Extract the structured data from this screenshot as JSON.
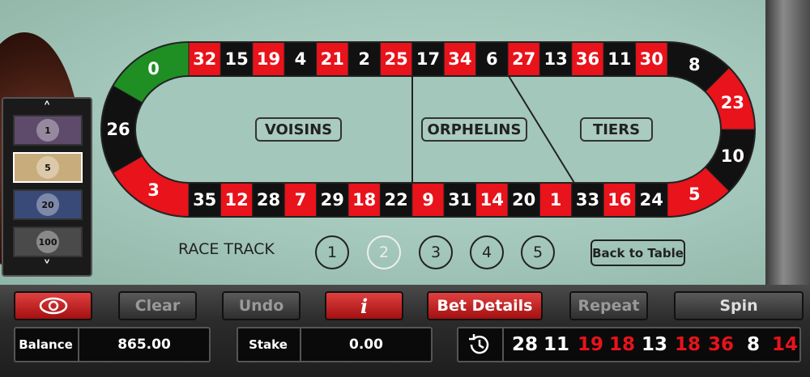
{
  "colors": {
    "red": "#e8131b",
    "black": "#111111",
    "green": "#1f8f24"
  },
  "race_track": {
    "top_row": [
      "32",
      "15",
      "19",
      "4",
      "21",
      "2",
      "25",
      "17",
      "34",
      "6",
      "27",
      "13",
      "36",
      "11",
      "30"
    ],
    "bottom_row": [
      "35",
      "12",
      "28",
      "7",
      "29",
      "18",
      "22",
      "9",
      "31",
      "14",
      "20",
      "1",
      "33",
      "16",
      "24"
    ],
    "left_curve": [
      "0",
      "26",
      "3"
    ],
    "right_curve": [
      "8",
      "23",
      "10",
      "5"
    ],
    "sections": {
      "voisins": "VOISINS",
      "orphelins": "ORPHELINS",
      "tiers": "TIERS"
    }
  },
  "neighbours": {
    "label": "RACE TRACK",
    "options": [
      "1",
      "2",
      "3",
      "4",
      "5"
    ],
    "selected": "2"
  },
  "back_to_table": "Back to Table",
  "chips": {
    "values": [
      "1",
      "5",
      "20",
      "100"
    ],
    "selected": "5",
    "up_icon": "chevron-up-icon",
    "down_icon": "chevron-down-icon"
  },
  "buttons": {
    "clear": "Clear",
    "undo": "Undo",
    "info": "i",
    "bet_details": "Bet Details",
    "repeat": "Repeat",
    "spin": "Spin"
  },
  "balance": {
    "label": "Balance",
    "value": "865.00"
  },
  "stake": {
    "label": "Stake",
    "value": "0.00"
  },
  "history": {
    "icon": "history-clock-icon",
    "numbers": [
      "28",
      "11",
      "19",
      "18",
      "13",
      "18",
      "36",
      "8",
      "14"
    ]
  }
}
